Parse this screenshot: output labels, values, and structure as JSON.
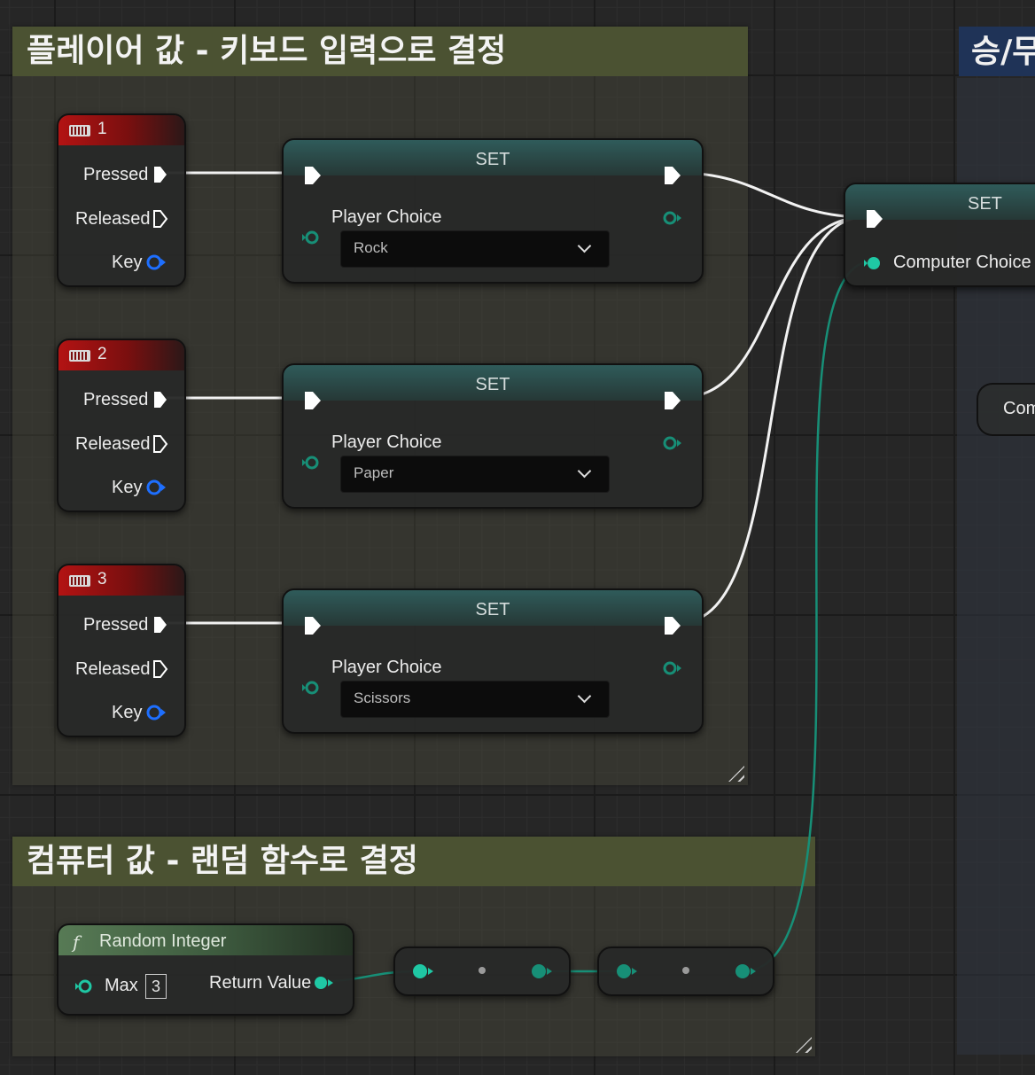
{
  "comments": {
    "player": "플레이어 값 - 키보드 입력으로 결정",
    "computer": "컴퓨터 값 - 랜덤 함수로 결정",
    "result": "승/무"
  },
  "key_nodes": [
    {
      "key": "1",
      "pins": {
        "pressed": "Pressed",
        "released": "Released",
        "key": "Key"
      }
    },
    {
      "key": "2",
      "pins": {
        "pressed": "Pressed",
        "released": "Released",
        "key": "Key"
      }
    },
    {
      "key": "3",
      "pins": {
        "pressed": "Pressed",
        "released": "Released",
        "key": "Key"
      }
    }
  ],
  "set_nodes": [
    {
      "title": "SET",
      "variable": "Player Choice",
      "value": "Rock"
    },
    {
      "title": "SET",
      "variable": "Player Choice",
      "value": "Paper"
    },
    {
      "title": "SET",
      "variable": "Player Choice",
      "value": "Scissors"
    }
  ],
  "set_computer": {
    "title": "SET",
    "variable": "Computer Choice"
  },
  "random_node": {
    "icon": "f",
    "title": "Random Integer",
    "max_label": "Max",
    "max_value": "3",
    "return_label": "Return Value"
  },
  "comp_pill": {
    "label": "Com"
  },
  "colors": {
    "exec": "#ffffff",
    "data": "#1fc8a4",
    "key_pin": "#1e6fff",
    "comment_title": "#4b5232",
    "key_header": "#b31313"
  }
}
